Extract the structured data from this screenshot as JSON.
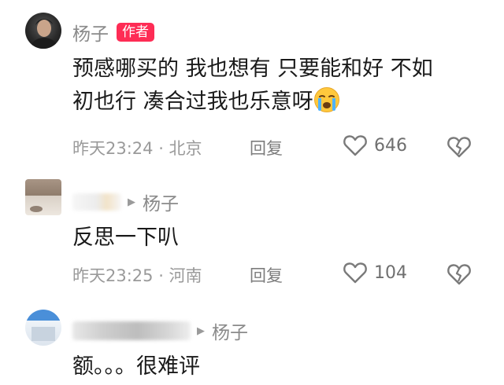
{
  "comments": [
    {
      "username": "杨子",
      "badge": "作者",
      "text_line1": "预感哪买的 我也想有 只要能和好 不如",
      "text_line2": "初也行 凑合过我也乐意呀",
      "emoji": "loudly-crying-face",
      "time_location": "昨天23:24 · 北京",
      "reply_label": "回复",
      "likes": "646"
    },
    {
      "reply_to": "杨子",
      "text": "反思一下叭",
      "time_location": "昨天23:25 · 河南",
      "reply_label": "回复",
      "likes": "104"
    },
    {
      "reply_to": "杨子",
      "text": "额。。。很难评"
    }
  ],
  "colors": {
    "author_badge": "#fe2c55",
    "meta_text": "#9a9a9a",
    "name_text": "#8a8a8a"
  }
}
